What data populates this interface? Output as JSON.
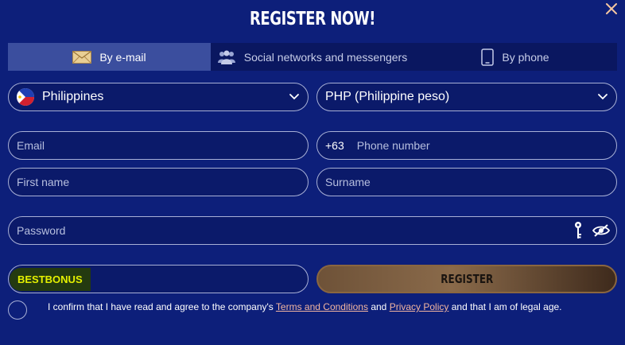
{
  "header": {
    "title": "REGISTER NOW!"
  },
  "tabs": [
    {
      "label": "By e-mail",
      "icon": "envelope-icon",
      "active": true
    },
    {
      "label": "Social networks and messengers",
      "icon": "users-icon",
      "active": false
    },
    {
      "label": "By phone",
      "icon": "phone-icon",
      "active": false
    }
  ],
  "country": {
    "value": "Philippines",
    "icon": "philippines-flag-icon"
  },
  "currency": {
    "value": "PHP (Philippine peso)"
  },
  "email": {
    "placeholder": "Email"
  },
  "phone": {
    "prefix": "+63",
    "placeholder": "Phone number"
  },
  "first_name": {
    "placeholder": "First name"
  },
  "surname": {
    "placeholder": "Surname"
  },
  "password": {
    "placeholder": "Password"
  },
  "promo": {
    "value": "BESTBONUS"
  },
  "register": {
    "label": "REGISTER"
  },
  "terms": {
    "prefix": "I confirm that I have read and agree to the company's",
    "terms_link": "Terms and Conditions",
    "and": "and",
    "privacy_link": "Privacy Policy",
    "suffix": "and that I am of legal age."
  },
  "colors": {
    "background": "#0d1f7a",
    "active_tab": "#3b4e9e",
    "promo_text": "#e4f000",
    "link": "#f2b5a0"
  }
}
